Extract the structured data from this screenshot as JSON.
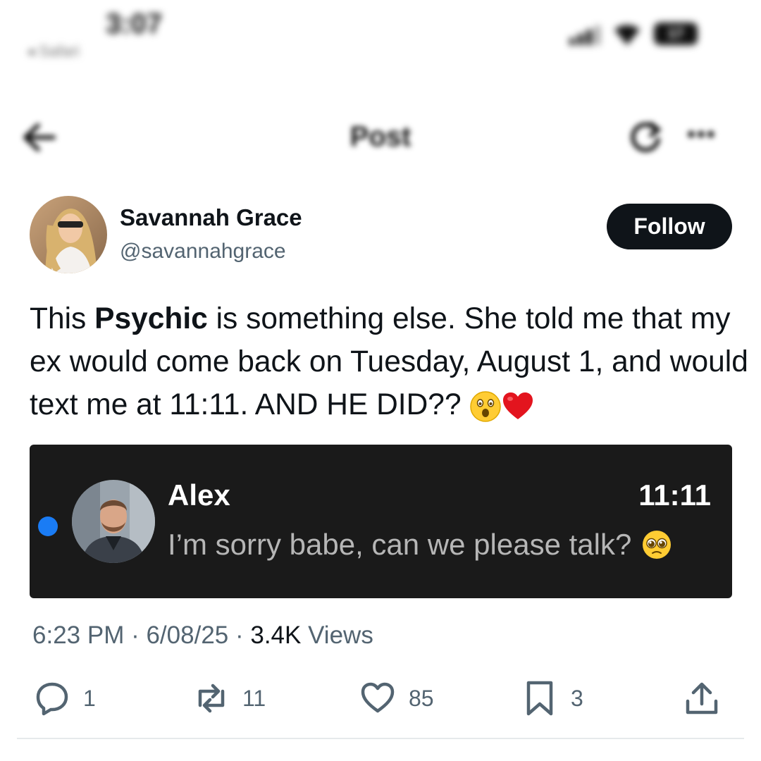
{
  "status_bar": {
    "time": "3:07",
    "back_app": "◂ Safari",
    "battery": "17"
  },
  "nav": {
    "title": "Post"
  },
  "author": {
    "name": "Savannah Grace",
    "handle": "@savannahgrace",
    "follow_label": "Follow"
  },
  "post": {
    "text_1": "This ",
    "text_bold": "Psychic",
    "text_2": " is something else. She told me that my ex would come back on Tuesday, August 1, and would text me at 11:11. AND HE DID?? ",
    "emojis": [
      "astonished-face",
      "red-heart"
    ]
  },
  "message_card": {
    "sender": "Alex",
    "time": "11:11",
    "preview": "I’m sorry babe, can we please talk?",
    "preview_emoji": "pleading-face",
    "unread": true
  },
  "meta": {
    "time": "6:23 PM",
    "separator": " · ",
    "date": "6/08/25",
    "views_count": "3.4K",
    "views_label": " Views"
  },
  "actions": {
    "replies": "1",
    "reposts": "11",
    "likes": "85",
    "bookmarks": "3"
  },
  "colors": {
    "text": "#0f1419",
    "secondary": "#536471",
    "card_bg": "#1a1a1a",
    "unread_dot": "#1a7cf5"
  }
}
